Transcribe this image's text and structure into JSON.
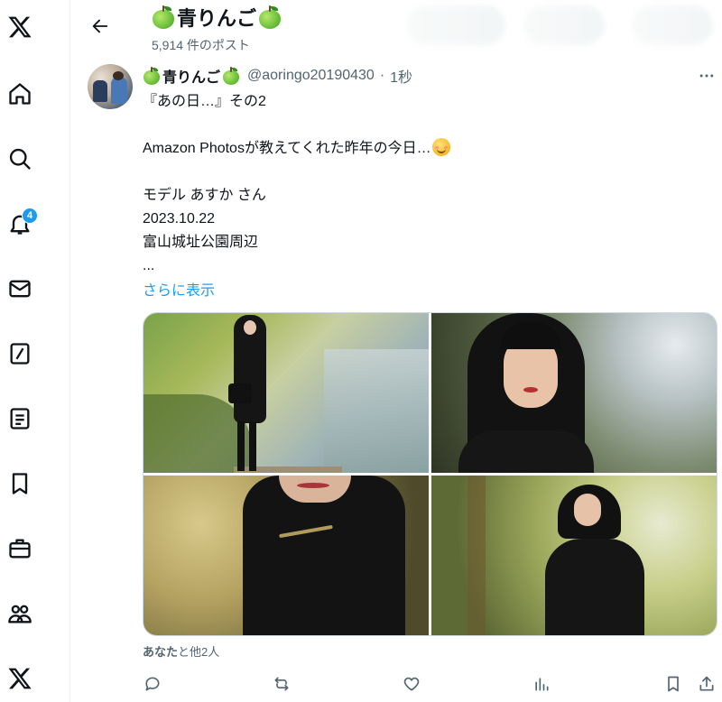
{
  "header": {
    "title": "青りんご",
    "post_count": "5,914 件のポスト"
  },
  "nav": {
    "notifications_badge": "4",
    "icons": [
      "x-logo",
      "home",
      "search",
      "notifications",
      "messages",
      "grok",
      "lists",
      "bookmarks",
      "jobs",
      "communities",
      "premium"
    ]
  },
  "tweet": {
    "author_name": "青りんご",
    "handle": "@aoringo20190430",
    "separator": "·",
    "time": "1秒",
    "lines": [
      "『あの日…』その2",
      "",
      "Amazon Photosが教えてくれた昨年の今日…",
      "",
      "モデル あすか さん",
      "2023.10.22",
      "富山城址公園周辺",
      "..."
    ],
    "show_more": "さらに表示",
    "liked_by": "あなた",
    "liked_by_suffix": "と他2人"
  },
  "colors": {
    "accent": "#1d9bf0",
    "text": "#0f1419",
    "secondary": "#536471"
  }
}
